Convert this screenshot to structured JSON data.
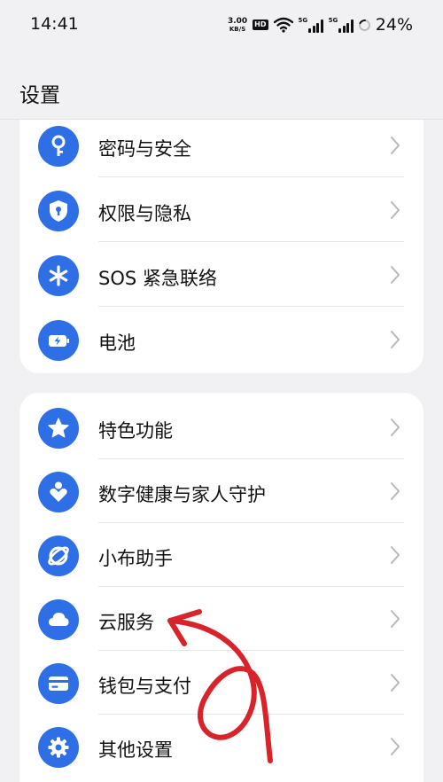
{
  "status_bar": {
    "time": "14:41",
    "net_speed_value": "3.00",
    "net_speed_unit": "KB/S",
    "hd_label": "HD",
    "sim1_tag": "5G",
    "sim2_tag": "5G",
    "battery_percent": "24%"
  },
  "header": {
    "title": "设置"
  },
  "groups": [
    {
      "items": [
        {
          "label": "密码与安全",
          "icon": "key-icon"
        },
        {
          "label": "权限与隐私",
          "icon": "shield-lock-icon"
        },
        {
          "label": "SOS 紧急联络",
          "icon": "asterisk-icon"
        },
        {
          "label": "电池",
          "icon": "battery-charging-icon"
        }
      ]
    },
    {
      "items": [
        {
          "label": "特色功能",
          "icon": "star-icon"
        },
        {
          "label": "数字健康与家人守护",
          "icon": "person-heart-icon"
        },
        {
          "label": "小布助手",
          "icon": "assistant-icon"
        },
        {
          "label": "云服务",
          "icon": "cloud-icon"
        },
        {
          "label": "钱包与支付",
          "icon": "wallet-card-icon"
        },
        {
          "label": "其他设置",
          "icon": "gear-icon"
        }
      ]
    }
  ],
  "colors": {
    "accent": "#2f6fe6",
    "annotation": "#d8232a"
  }
}
